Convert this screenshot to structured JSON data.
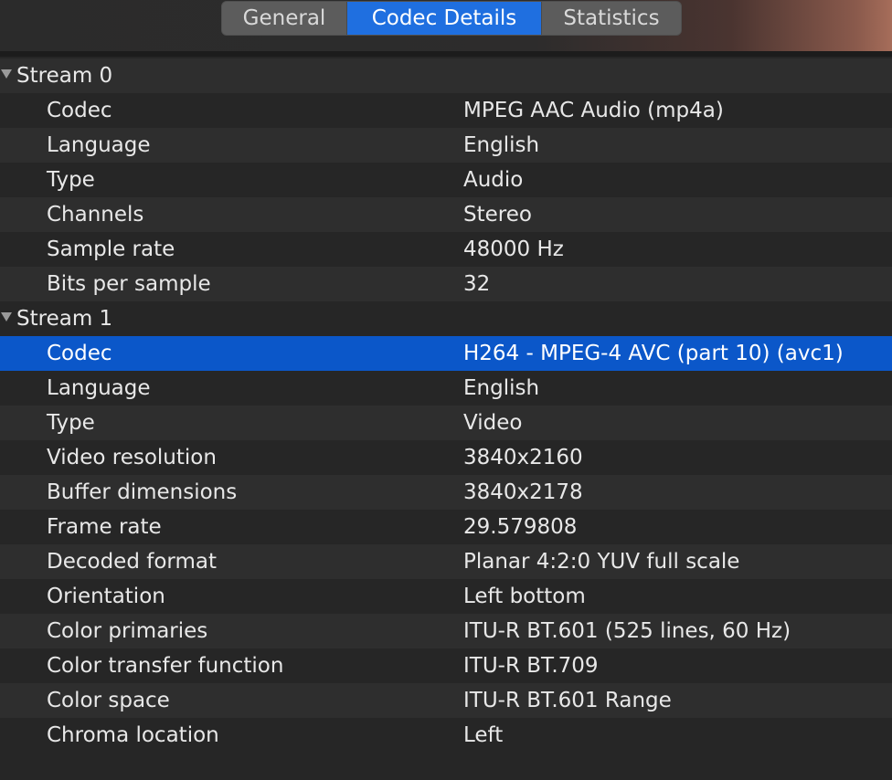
{
  "tabs": [
    {
      "label": "General",
      "active": false
    },
    {
      "label": "Codec Details",
      "active": true
    },
    {
      "label": "Statistics",
      "active": false
    }
  ],
  "streams": [
    {
      "title": "Stream 0",
      "expanded": true,
      "properties": [
        {
          "label": "Codec",
          "value": "MPEG AAC Audio (mp4a)"
        },
        {
          "label": "Language",
          "value": "English"
        },
        {
          "label": "Type",
          "value": "Audio"
        },
        {
          "label": "Channels",
          "value": "Stereo"
        },
        {
          "label": "Sample rate",
          "value": "48000 Hz"
        },
        {
          "label": "Bits per sample",
          "value": "32"
        }
      ]
    },
    {
      "title": "Stream 1",
      "expanded": true,
      "properties": [
        {
          "label": "Codec",
          "value": "H264 - MPEG-4 AVC (part 10) (avc1)",
          "selected": true
        },
        {
          "label": "Language",
          "value": "English"
        },
        {
          "label": "Type",
          "value": "Video"
        },
        {
          "label": "Video resolution",
          "value": "3840x2160"
        },
        {
          "label": "Buffer dimensions",
          "value": "3840x2178"
        },
        {
          "label": "Frame rate",
          "value": "29.579808"
        },
        {
          "label": "Decoded format",
          "value": "Planar 4:2:0 YUV full scale"
        },
        {
          "label": "Orientation",
          "value": "Left bottom"
        },
        {
          "label": "Color primaries",
          "value": "ITU-R BT.601 (525 lines, 60 Hz)"
        },
        {
          "label": "Color transfer function",
          "value": "ITU-R BT.709"
        },
        {
          "label": "Color space",
          "value": "ITU-R BT.601 Range"
        },
        {
          "label": "Chroma location",
          "value": "Left"
        }
      ]
    }
  ],
  "colors": {
    "accent": "#1f6fe0",
    "selection": "#0b57c9",
    "background": "#262626",
    "row_alt": "#2e2e2e"
  }
}
